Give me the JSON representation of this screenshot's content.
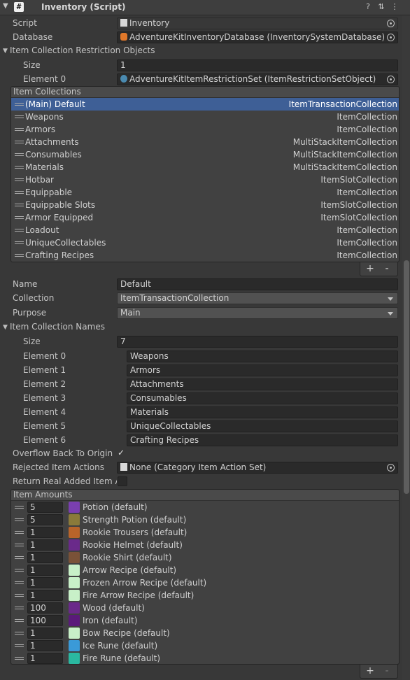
{
  "header": {
    "title": "Inventory (Script)",
    "icon_letter": "#",
    "buttons": [
      "help-icon",
      "settings-sliders-icon",
      "more-icon"
    ]
  },
  "script_row": {
    "label": "Script",
    "value": "Inventory"
  },
  "database_row": {
    "label": "Database",
    "value": "AdventureKitInventoryDatabase (InventorySystemDatabase)"
  },
  "restriction": {
    "label": "Item Collection Restriction Objects",
    "size_label": "Size",
    "size_value": "1",
    "element0_label": "Element 0",
    "element0_value": "AdventureKitItemRestrictionSet (ItemRestrictionSetObject)"
  },
  "item_collections": {
    "header": "Item Collections",
    "rows": [
      {
        "name": "(Main) Default",
        "type": "ItemTransactionCollection",
        "selected": true
      },
      {
        "name": "Weapons",
        "type": "ItemCollection"
      },
      {
        "name": "Armors",
        "type": "ItemCollection"
      },
      {
        "name": "Attachments",
        "type": "MultiStackItemCollection"
      },
      {
        "name": "Consumables",
        "type": "MultiStackItemCollection"
      },
      {
        "name": "Materials",
        "type": "MultiStackItemCollection"
      },
      {
        "name": "Hotbar",
        "type": "ItemSlotCollection"
      },
      {
        "name": "Equippable",
        "type": "ItemCollection"
      },
      {
        "name": "Equippable Slots",
        "type": "ItemSlotCollection"
      },
      {
        "name": "Armor Equipped",
        "type": "ItemSlotCollection"
      },
      {
        "name": "Loadout",
        "type": "ItemCollection"
      },
      {
        "name": "UniqueCollectables",
        "type": "ItemCollection"
      },
      {
        "name": "Crafting Recipes",
        "type": "ItemCollection"
      }
    ],
    "add": "+",
    "remove": "-"
  },
  "details": {
    "name_label": "Name",
    "name_value": "Default",
    "collection_label": "Collection",
    "collection_value": "ItemTransactionCollection",
    "purpose_label": "Purpose",
    "purpose_value": "Main"
  },
  "collection_names": {
    "label": "Item Collection Names",
    "size_label": "Size",
    "size_value": "7",
    "elements": [
      {
        "label": "Element 0",
        "value": "Weapons"
      },
      {
        "label": "Element 1",
        "value": "Armors"
      },
      {
        "label": "Element 2",
        "value": "Attachments"
      },
      {
        "label": "Element 3",
        "value": "Consumables"
      },
      {
        "label": "Element 4",
        "value": "Materials"
      },
      {
        "label": "Element 5",
        "value": "UniqueCollectables"
      },
      {
        "label": "Element 6",
        "value": "Crafting Recipes"
      }
    ]
  },
  "overflow": {
    "label": "Overflow Back To Origin",
    "checked": true,
    "check_glyph": "✓"
  },
  "rejected": {
    "label": "Rejected Item Actions",
    "value": "None (Category Item Action Set)"
  },
  "return_real": {
    "label": "Return Real Added Item Am",
    "checked": false
  },
  "item_amounts": {
    "header": "Item Amounts",
    "rows": [
      {
        "amount": "5",
        "name": "Potion (default)",
        "icon_color": "#7a3fb0",
        "icon": "potion-icon"
      },
      {
        "amount": "5",
        "name": "Strength Potion (default)",
        "icon_color": "#8a7a3a",
        "icon": "strength-potion-icon"
      },
      {
        "amount": "1",
        "name": "Rookie Trousers (default)",
        "icon_color": "#b8642a",
        "icon": "trousers-icon"
      },
      {
        "amount": "1",
        "name": "Rookie Helmet (default)",
        "icon_color": "#6a2a8a",
        "icon": "helmet-icon"
      },
      {
        "amount": "1",
        "name": "Rookie Shirt (default)",
        "icon_color": "#7a5238",
        "icon": "shirt-icon"
      },
      {
        "amount": "1",
        "name": "Arrow Recipe (default)",
        "icon_color": "#c8f0c8",
        "icon": "recipe-icon"
      },
      {
        "amount": "1",
        "name": "Frozen Arrow Recipe (default)",
        "icon_color": "#c8f0c8",
        "icon": "recipe-icon"
      },
      {
        "amount": "1",
        "name": "Fire Arrow Recipe (default)",
        "icon_color": "#c8f0c8",
        "icon": "recipe-icon"
      },
      {
        "amount": "100",
        "name": "Wood (default)",
        "icon_color": "#6a2a8a",
        "icon": "wood-icon"
      },
      {
        "amount": "100",
        "name": "Iron (default)",
        "icon_color": "#5a1a7a",
        "icon": "iron-icon"
      },
      {
        "amount": "1",
        "name": "Bow Recipe (default)",
        "icon_color": "#c8f0c8",
        "icon": "recipe-icon"
      },
      {
        "amount": "1",
        "name": "Ice Rune (default)",
        "icon_color": "#3a9ad8",
        "icon": "ice-rune-icon"
      },
      {
        "amount": "1",
        "name": "Fire Rune (default)",
        "icon_color": "#2ab8a0",
        "icon": "fire-rune-icon"
      }
    ],
    "add": "+",
    "remove": "-"
  },
  "colors": {
    "background": "#383838",
    "selected_row": "#3e5f96",
    "field": "#2a2a2a"
  }
}
